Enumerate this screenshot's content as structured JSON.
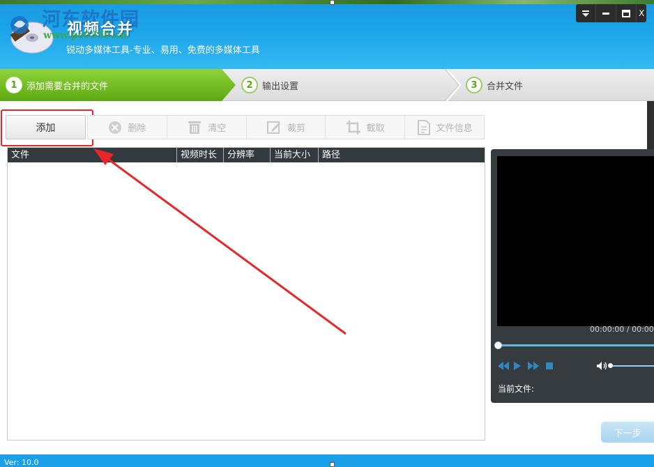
{
  "header": {
    "title": "视频合并",
    "subtitle": "锐动多媒体工具-专业、易用、免费的多媒体工具",
    "watermark_name": "河东软件园",
    "watermark_url": "www.pc0359.cn"
  },
  "window_controls": {
    "menu_icon": "dropdown-menu-icon",
    "minimize_icon": "minimize-icon",
    "maximize_icon": "maximize-icon",
    "close_label": "X"
  },
  "steps": [
    {
      "num": "1",
      "label": "添加需要合并的文件",
      "active": true
    },
    {
      "num": "2",
      "label": "输出设置",
      "active": false
    },
    {
      "num": "3",
      "label": "合并文件",
      "active": false
    }
  ],
  "toolbar": {
    "add_label": "添加",
    "tools": [
      {
        "label": "删除",
        "icon": "delete-circle-icon"
      },
      {
        "label": "清空",
        "icon": "trash-icon"
      },
      {
        "label": "裁剪",
        "icon": "edit-icon"
      },
      {
        "label": "截取",
        "icon": "crop-icon"
      },
      {
        "label": "文件信息",
        "icon": "file-info-icon"
      }
    ]
  },
  "file_list": {
    "columns": [
      "文件",
      "视频时长",
      "分辨率",
      "当前大小",
      "路径"
    ],
    "rows": []
  },
  "player": {
    "time": "00:00:00 / 00:00:",
    "current_file_label": "当前文件:"
  },
  "next_label": "下一步",
  "version": "Ver: 10.0",
  "colors": {
    "header_blue": "#1aa3e8",
    "step_green": "#5da812",
    "annotation_red": "#e8262a",
    "table_header": "#333a3e"
  }
}
